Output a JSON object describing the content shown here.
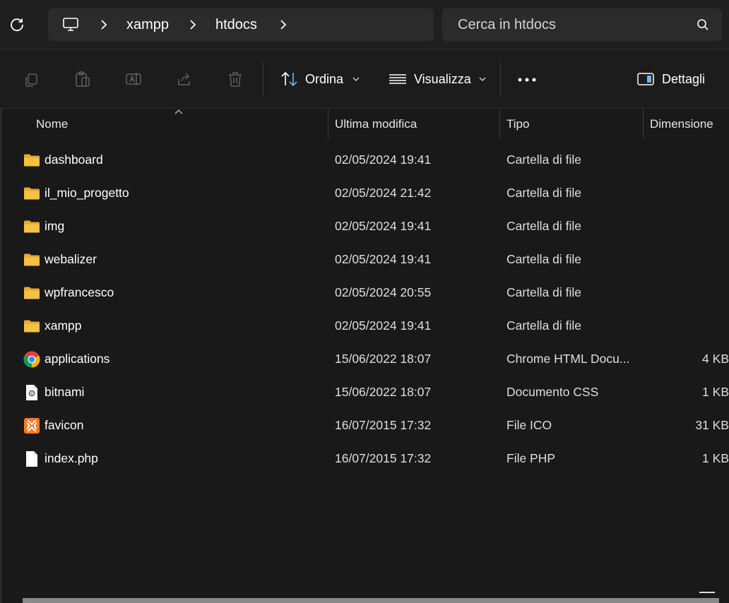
{
  "breadcrumb": {
    "items": [
      "xampp",
      "htdocs"
    ]
  },
  "search": {
    "placeholder": "Cerca in htdocs"
  },
  "toolbar": {
    "sort_label": "Ordina",
    "view_label": "Visualizza",
    "details_label": "Dettagli"
  },
  "columns": {
    "name": "Nome",
    "modified": "Ultima modifica",
    "type": "Tipo",
    "size": "Dimensione"
  },
  "files": [
    {
      "name": "dashboard",
      "modified": "02/05/2024 19:41",
      "type": "Cartella di file",
      "size": "",
      "icon": "folder-icon"
    },
    {
      "name": "il_mio_progetto",
      "modified": "02/05/2024 21:42",
      "type": "Cartella di file",
      "size": "",
      "icon": "folder-icon"
    },
    {
      "name": "img",
      "modified": "02/05/2024 19:41",
      "type": "Cartella di file",
      "size": "",
      "icon": "folder-icon"
    },
    {
      "name": "webalizer",
      "modified": "02/05/2024 19:41",
      "type": "Cartella di file",
      "size": "",
      "icon": "folder-icon"
    },
    {
      "name": "wpfrancesco",
      "modified": "02/05/2024 20:55",
      "type": "Cartella di file",
      "size": "",
      "icon": "folder-icon"
    },
    {
      "name": "xampp",
      "modified": "02/05/2024 19:41",
      "type": "Cartella di file",
      "size": "",
      "icon": "folder-icon"
    },
    {
      "name": "applications",
      "modified": "15/06/2022 18:07",
      "type": "Chrome HTML Docu...",
      "size": "4 KB",
      "icon": "chrome-icon"
    },
    {
      "name": "bitnami",
      "modified": "15/06/2022 18:07",
      "type": "Documento CSS",
      "size": "1 KB",
      "icon": "css-file-icon"
    },
    {
      "name": "favicon",
      "modified": "16/07/2015 17:32",
      "type": "File ICO",
      "size": "31 KB",
      "icon": "xampp-icon"
    },
    {
      "name": "index.php",
      "modified": "16/07/2015 17:32",
      "type": "File PHP",
      "size": "1 KB",
      "icon": "file-icon"
    }
  ],
  "colors": {
    "background": "#191919",
    "folder": "#f3c143",
    "xampp_orange": "#fb7a24"
  }
}
